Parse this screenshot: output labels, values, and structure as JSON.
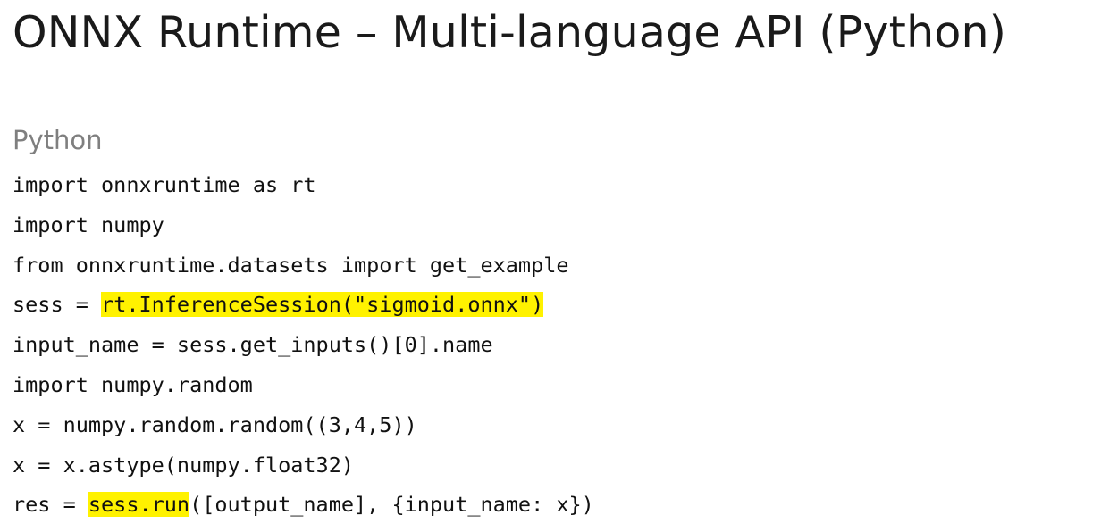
{
  "slide": {
    "title": "ONNX Runtime – Multi-language API (Python)",
    "section_heading": "Python",
    "highlight_color": "#fff200",
    "code_lines": [
      {
        "before": "import onnxruntime as rt",
        "highlight": "",
        "after": ""
      },
      {
        "before": "import numpy",
        "highlight": "",
        "after": ""
      },
      {
        "before": "from onnxruntime.datasets import get_example",
        "highlight": "",
        "after": ""
      },
      {
        "before": "sess = ",
        "highlight": "rt.InferenceSession(\"sigmoid.onnx\")",
        "after": ""
      },
      {
        "before": "input_name = sess.get_inputs()[0].name",
        "highlight": "",
        "after": ""
      },
      {
        "before": "import numpy.random",
        "highlight": "",
        "after": ""
      },
      {
        "before": "x = numpy.random.random((3,4,5))",
        "highlight": "",
        "after": ""
      },
      {
        "before": "x = x.astype(numpy.float32)",
        "highlight": "",
        "after": ""
      },
      {
        "before": "res = ",
        "highlight": "sess.run",
        "after": "([output_name], {input_name: x})"
      }
    ]
  }
}
